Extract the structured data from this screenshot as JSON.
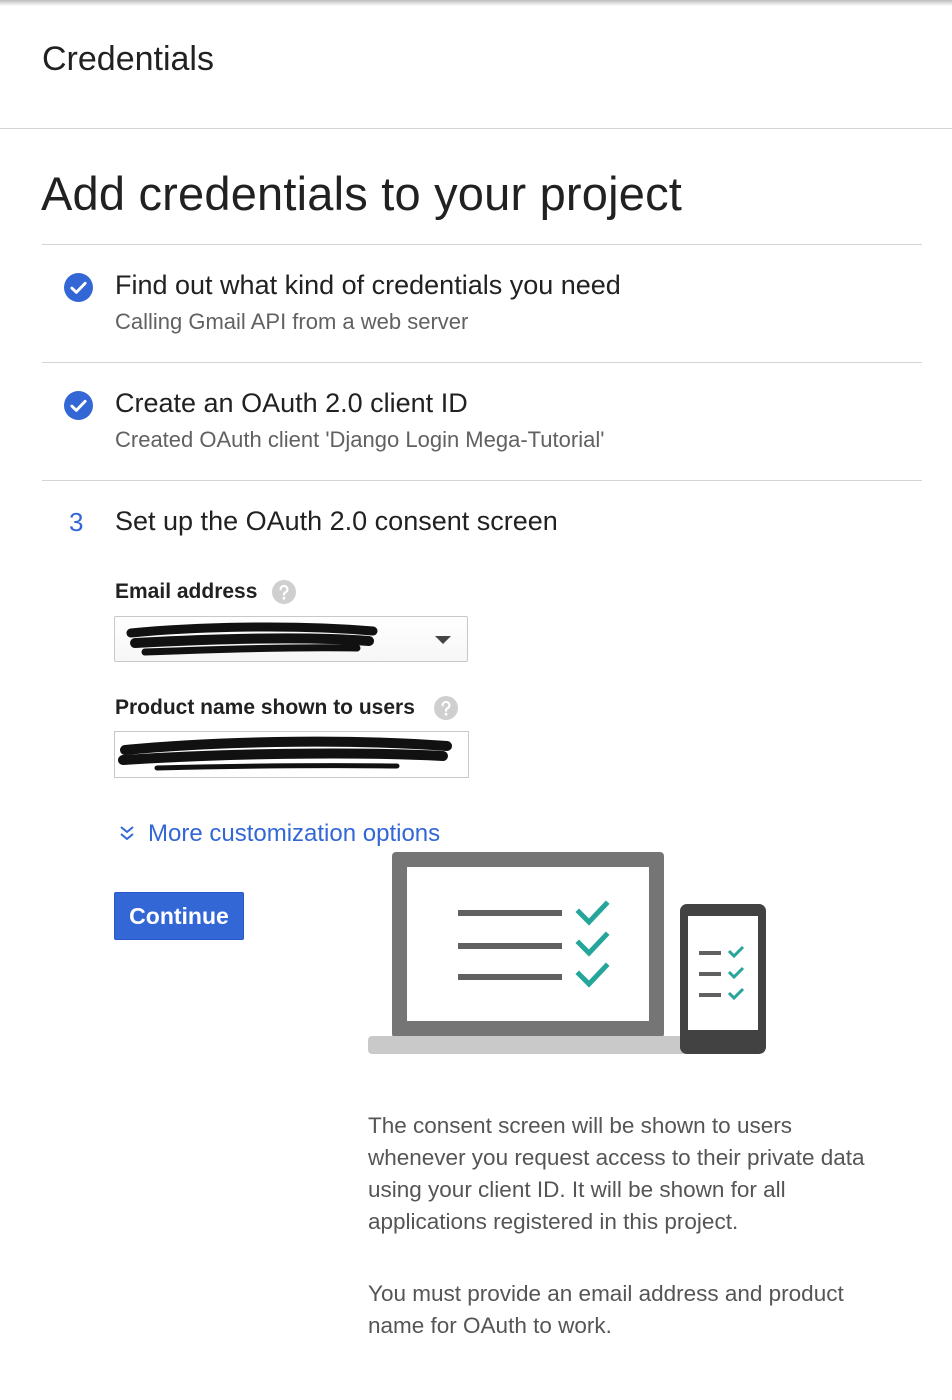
{
  "header": {
    "title": "Credentials"
  },
  "page": {
    "title": "Add credentials to your project"
  },
  "steps": [
    {
      "status": "done",
      "title": "Find out what kind of credentials you need",
      "subtitle": "Calling Gmail API from a web server"
    },
    {
      "status": "done",
      "title": "Create an OAuth 2.0 client ID",
      "subtitle": "Created OAuth client 'Django Login Mega-Tutorial'"
    },
    {
      "status": "current",
      "number": "3",
      "title": "Set up the OAuth 2.0 consent screen"
    }
  ],
  "form": {
    "email": {
      "label": "Email address",
      "value": "",
      "value_redacted": true
    },
    "product_name": {
      "label": "Product name shown to users",
      "value": "",
      "value_redacted": true
    },
    "more_options_label": "More customization options",
    "continue_label": "Continue"
  },
  "description": [
    "The consent screen will be shown to users whenever you request access to their private data using your client ID. It will be shown for all applications registered in this project.",
    "You must provide an email address and product name for OAuth to work."
  ],
  "colors": {
    "accent": "#3367d6",
    "check_teal": "#26a69a",
    "device_gray": "#757575"
  },
  "icons": [
    "check-circle-icon",
    "help-icon",
    "dropdown-arrow-icon",
    "chevron-double-down-icon",
    "consent-screen-illustration"
  ]
}
